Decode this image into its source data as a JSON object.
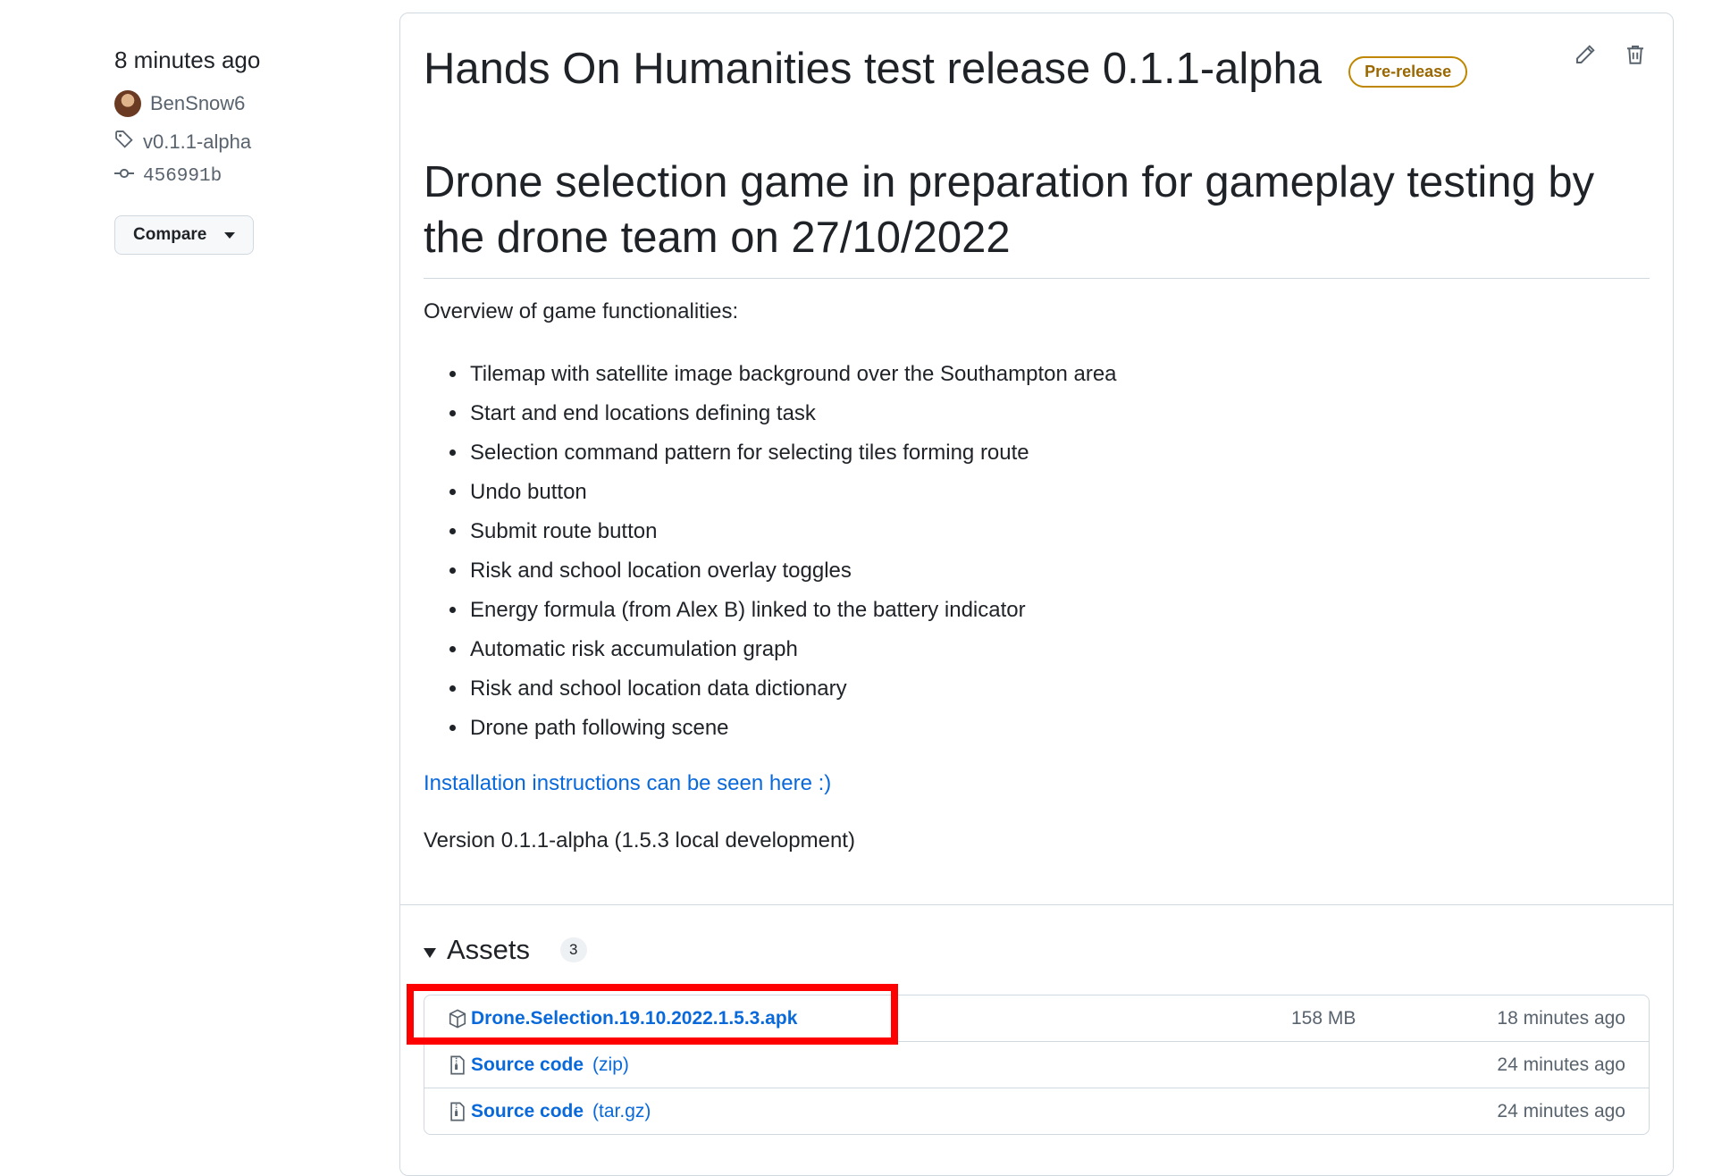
{
  "sidebar": {
    "published_time": "8 minutes ago",
    "author": "BenSnow6",
    "tag": "v0.1.1-alpha",
    "commit": "456991b",
    "compare_label": "Compare"
  },
  "release": {
    "title": "Hands On Humanities test release 0.1.1-alpha",
    "badge": "Pre-release",
    "heading": "Drone selection game in preparation for gameplay testing by the drone team on 27/10/2022",
    "overview": "Overview of game functionalities:",
    "features": [
      "Tilemap with satellite image background over the Southampton area",
      "Start and end locations defining task",
      "Selection command pattern for selecting tiles forming route",
      "Undo button",
      "Submit route button",
      "Risk and school location overlay toggles",
      "Energy formula (from Alex B) linked to the battery indicator",
      "Automatic risk accumulation graph",
      "Risk and school location data dictionary",
      "Drone path following scene"
    ],
    "install_link": "Installation instructions can be seen here :)",
    "version": "Version 0.1.1-alpha (1.5.3 local development)"
  },
  "assets": {
    "title": "Assets",
    "count": "3",
    "items": [
      {
        "name": "Drone.Selection.19.10.2022.1.5.3.apk",
        "suffix": "",
        "size": "158 MB",
        "time": "18 minutes ago"
      },
      {
        "name": "Source code",
        "suffix": "(zip)",
        "size": "",
        "time": "24 minutes ago"
      },
      {
        "name": "Source code",
        "suffix": "(tar.gz)",
        "size": "",
        "time": "24 minutes ago"
      }
    ]
  },
  "colors": {
    "link": "#0969da",
    "prerelease": "#9a6700",
    "highlight": "#ff0000"
  }
}
